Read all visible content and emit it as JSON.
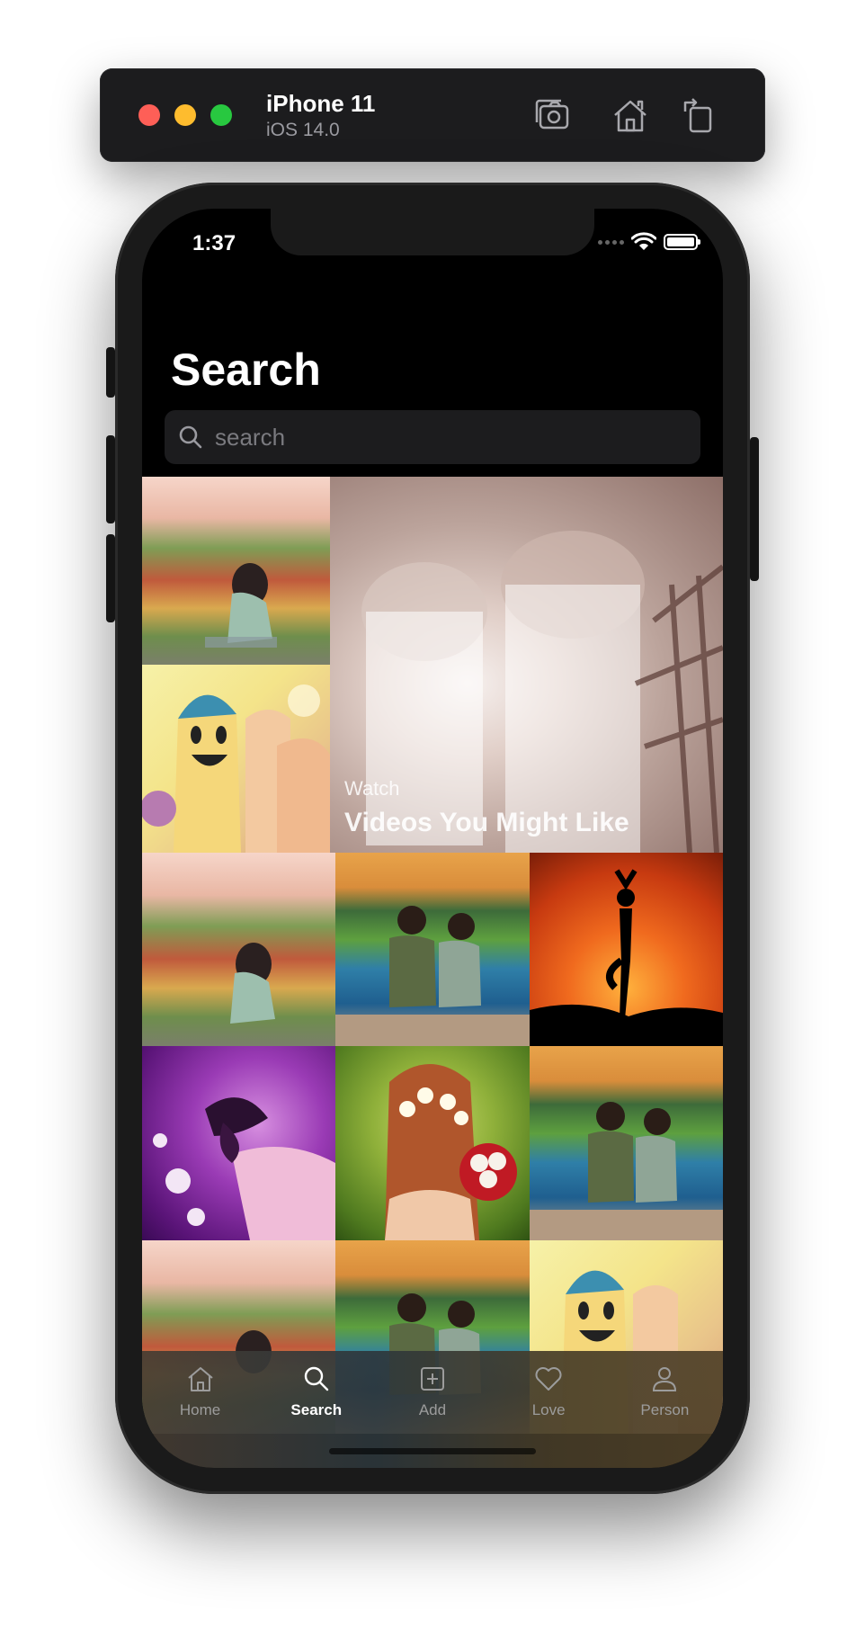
{
  "simulator": {
    "device_name": "iPhone 11",
    "os_version": "iOS 14.0",
    "icons": [
      "screenshot-icon",
      "home-icon",
      "rotate-icon"
    ]
  },
  "status_bar": {
    "time": "1:37"
  },
  "page": {
    "title": "Search"
  },
  "search": {
    "placeholder": "search",
    "value": ""
  },
  "hero": {
    "kicker": "Watch",
    "title": "Videos You Might Like"
  },
  "tabs": [
    {
      "label": "Home",
      "icon": "home-icon",
      "active": false
    },
    {
      "label": "Search",
      "icon": "search-icon",
      "active": true
    },
    {
      "label": "Add",
      "icon": "add-icon",
      "active": false
    },
    {
      "label": "Love",
      "icon": "heart-icon",
      "active": false
    },
    {
      "label": "Person",
      "icon": "person-icon",
      "active": false
    }
  ],
  "colors": {
    "background": "#000000",
    "search_field": "#1c1c1e",
    "tab_active": "#ffffff",
    "tab_inactive": "#9c9c9c"
  }
}
